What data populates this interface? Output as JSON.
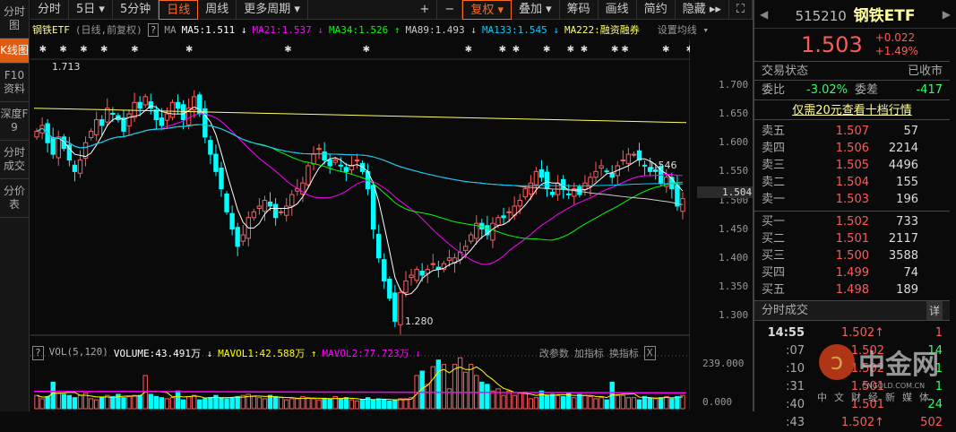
{
  "left_tabs": [
    "分时图",
    "K线图",
    "F10资料",
    "深度F9",
    "分时成交",
    "分价表"
  ],
  "toolbar": {
    "left": [
      "分时",
      "5日 ▾",
      "5分钟",
      "日线",
      "周线",
      "更多周期 ▾"
    ],
    "right": [
      "+",
      "−",
      "复权 ▾",
      "叠加 ▾",
      "筹码",
      "画线",
      "简约",
      "隐藏 ▸▸",
      "⛶"
    ]
  },
  "legend": {
    "name": "钢铁ETF",
    "mode": "(日线,前复权)",
    "help": "?",
    "ma": "MA",
    "ma5": "MA5:1.511 ↓",
    "ma21": "MA21:1.537 ↓",
    "ma34": "MA34:1.526 ↑",
    "ma89": "MA89:1.493 ↓",
    "ma133": "MA133:1.545 ↓",
    "ma222": "MA222:融资融券",
    "settings": "设置均线 ▾"
  },
  "annotations": {
    "high": "1.713",
    "low": "1.280",
    "right": "1.546"
  },
  "price_axis": [
    "1.700",
    "1.650",
    "1.600",
    "1.550",
    "1.500",
    "1.450",
    "1.400",
    "1.350",
    "1.300"
  ],
  "current_price_tag": "1.504",
  "volume_legend": {
    "help": "?",
    "name": "VOL(5,120)",
    "volume": "VOLUME:43.491万 ↓",
    "mavol1": "MAVOL1:42.588万 ↑",
    "mavol2": "MAVOL2:77.723万 ↓",
    "btns": [
      "改参数",
      "加指标",
      "换指标",
      "X"
    ]
  },
  "volume_axis": [
    "239.000",
    "0.000"
  ],
  "colors": {
    "up": "#ff5a5a",
    "down": "#00ffff",
    "ma5": "#ffffff",
    "ma21": "#ff00ff",
    "ma34": "#00ff00",
    "ma89": "#cccccc",
    "ma133": "#00ccff",
    "ma222": "#ffff66",
    "accent": "#ff6a1a"
  },
  "chart_data": {
    "type": "candlestick",
    "y_range": [
      1.28,
      1.713
    ],
    "closes": [
      1.62,
      1.63,
      1.6,
      1.58,
      1.61,
      1.59,
      1.57,
      1.55,
      1.57,
      1.6,
      1.62,
      1.64,
      1.63,
      1.66,
      1.65,
      1.64,
      1.62,
      1.65,
      1.67,
      1.66,
      1.68,
      1.66,
      1.64,
      1.63,
      1.65,
      1.67,
      1.66,
      1.64,
      1.66,
      1.68,
      1.65,
      1.61,
      1.58,
      1.55,
      1.52,
      1.48,
      1.45,
      1.42,
      1.44,
      1.47,
      1.48,
      1.49,
      1.5,
      1.49,
      1.47,
      1.48,
      1.49,
      1.51,
      1.52,
      1.53,
      1.56,
      1.58,
      1.59,
      1.57,
      1.56,
      1.57,
      1.56,
      1.55,
      1.56,
      1.57,
      1.55,
      1.52,
      1.45,
      1.4,
      1.36,
      1.33,
      1.29,
      1.34,
      1.36,
      1.37,
      1.38,
      1.37,
      1.38,
      1.39,
      1.38,
      1.39,
      1.4,
      1.4,
      1.41,
      1.42,
      1.44,
      1.46,
      1.45,
      1.44,
      1.46,
      1.47,
      1.47,
      1.48,
      1.49,
      1.5,
      1.52,
      1.53,
      1.55,
      1.54,
      1.52,
      1.51,
      1.53,
      1.52,
      1.51,
      1.52,
      1.51,
      1.53,
      1.54,
      1.55,
      1.56,
      1.55,
      1.54,
      1.56,
      1.57,
      1.58,
      1.58,
      1.57,
      1.56,
      1.55,
      1.55,
      1.53,
      1.54,
      1.52,
      1.49,
      1.503
    ],
    "volumes": [
      60,
      45,
      55,
      120,
      70,
      65,
      60,
      50,
      60,
      70,
      45,
      40,
      50,
      60,
      55,
      65,
      50,
      55,
      60,
      60,
      150,
      65,
      55,
      50,
      45,
      50,
      80,
      40,
      55,
      60,
      40,
      45,
      50,
      60,
      50,
      45,
      50,
      55,
      60,
      65,
      55,
      50,
      45,
      60,
      55,
      50,
      40,
      45,
      45,
      55,
      50,
      45,
      40,
      45,
      45,
      55,
      45,
      50,
      40,
      35,
      40,
      50,
      40,
      45,
      40,
      35,
      40,
      45,
      45,
      50,
      150,
      170,
      110,
      190,
      220,
      200,
      90,
      200,
      230,
      165,
      200,
      150,
      120,
      110,
      80,
      90,
      60,
      80,
      60,
      70,
      75,
      45,
      50,
      80,
      60,
      65,
      60,
      55,
      70,
      50,
      65,
      60,
      55,
      45,
      50,
      40,
      120,
      60,
      60,
      50,
      50,
      40,
      55,
      50,
      45,
      50,
      55,
      45,
      55,
      60,
      55,
      50,
      60,
      55,
      45,
      50,
      60,
      55,
      50,
      45,
      45,
      40,
      40,
      45,
      40,
      40,
      45,
      40
    ],
    "volume_range": [
      0,
      239
    ]
  },
  "quote": {
    "code": "515210",
    "name": "钢铁ETF",
    "price": "1.503",
    "change": "+0.022",
    "pct": "+1.49%",
    "status_label": "交易状态",
    "status": "已收市",
    "ratio_label": "委比",
    "ratio": "-3.02%",
    "diff_label": "委差",
    "diff": "-417",
    "promo": "仅需20元查看十档行情"
  },
  "asks": [
    {
      "n": "卖五",
      "p": "1.507",
      "v": "57"
    },
    {
      "n": "卖四",
      "p": "1.506",
      "v": "2214"
    },
    {
      "n": "卖三",
      "p": "1.505",
      "v": "4496"
    },
    {
      "n": "卖二",
      "p": "1.504",
      "v": "155"
    },
    {
      "n": "卖一",
      "p": "1.503",
      "v": "196"
    }
  ],
  "bids": [
    {
      "n": "买一",
      "p": "1.502",
      "v": "733"
    },
    {
      "n": "买二",
      "p": "1.501",
      "v": "2117"
    },
    {
      "n": "买三",
      "p": "1.500",
      "v": "3588"
    },
    {
      "n": "买四",
      "p": "1.499",
      "v": "74"
    },
    {
      "n": "买五",
      "p": "1.498",
      "v": "189"
    }
  ],
  "trades_title": "分时成交",
  "trades_detail": "详",
  "trades": [
    {
      "t": "14:55",
      "p": "1.502↑",
      "v": "1",
      "c": "#ff5a5a"
    },
    {
      "t": ":07",
      "p": "1.502",
      "v": "14",
      "c": "#33ff66"
    },
    {
      "t": ":10",
      "p": "1.502",
      "v": "1",
      "c": "#33ff66"
    },
    {
      "t": ":31",
      "p": "1.501",
      "v": "1",
      "c": "#33ff66"
    },
    {
      "t": ":40",
      "p": "1.501",
      "v": "24",
      "c": "#33ff66"
    },
    {
      "t": ":43",
      "p": "1.502↑",
      "v": "502",
      "c": "#ff5a5a"
    }
  ],
  "watermark": {
    "logo": "中金网",
    "url": "CNGOLD.COM.CN",
    "tagline": "中文财经新媒体"
  }
}
